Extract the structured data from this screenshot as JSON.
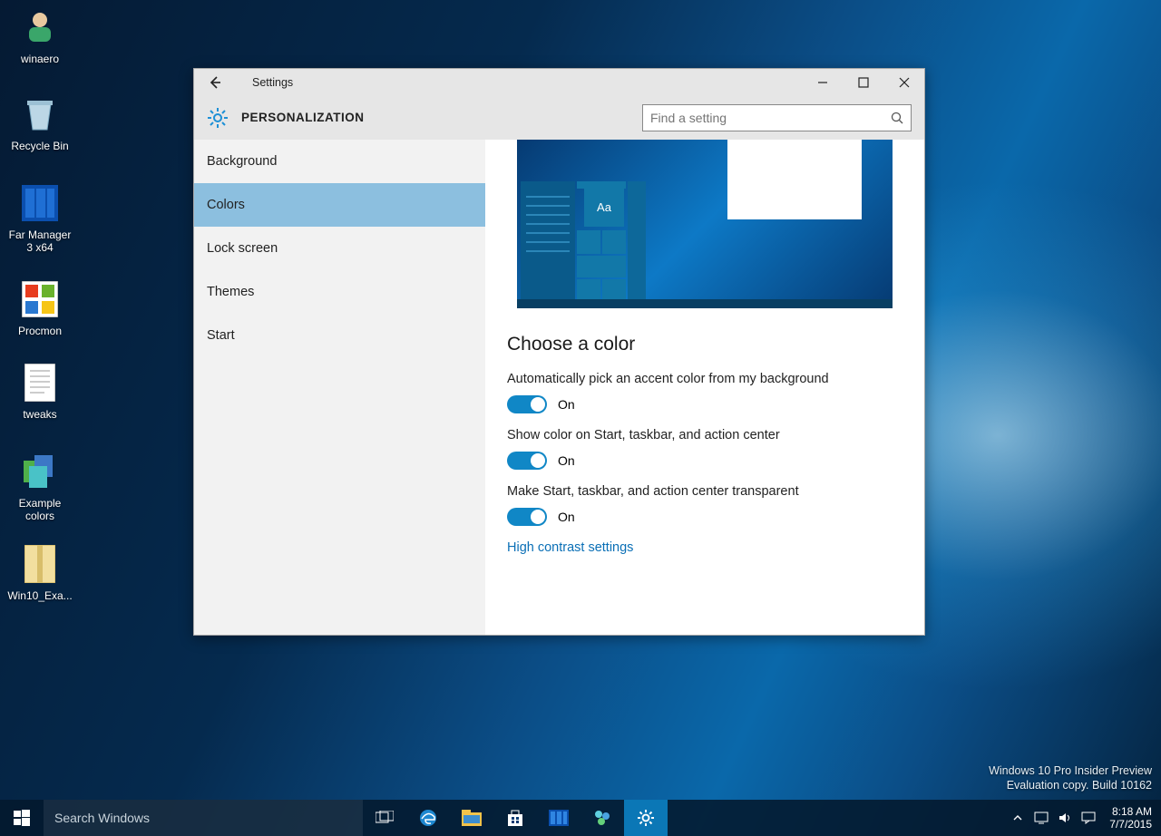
{
  "desktop_icons": [
    {
      "label": "winaero"
    },
    {
      "label": "Recycle Bin"
    },
    {
      "label": "Far Manager 3 x64"
    },
    {
      "label": "Procmon"
    },
    {
      "label": "tweaks"
    },
    {
      "label": "Example colors"
    },
    {
      "label": "Win10_Exa..."
    }
  ],
  "window": {
    "title": "Settings",
    "header": "PERSONALIZATION",
    "search_placeholder": "Find a setting"
  },
  "sidebar": {
    "items": [
      {
        "label": "Background"
      },
      {
        "label": "Colors"
      },
      {
        "label": "Lock screen"
      },
      {
        "label": "Themes"
      },
      {
        "label": "Start"
      }
    ],
    "active_index": 1
  },
  "main": {
    "preview_sample": "Aa",
    "section_heading": "Choose a color",
    "options": [
      {
        "label": "Automatically pick an accent color from my background",
        "state": "On",
        "on": true
      },
      {
        "label": "Show color on Start, taskbar, and action center",
        "state": "On",
        "on": true
      },
      {
        "label": "Make Start, taskbar, and action center transparent",
        "state": "On",
        "on": true
      }
    ],
    "link": "High contrast settings"
  },
  "watermark": {
    "line1": "Windows 10 Pro Insider Preview",
    "line2": "Evaluation copy. Build 10162"
  },
  "taskbar": {
    "search_placeholder": "Search Windows",
    "time": "8:18 AM",
    "date": "7/7/2015"
  }
}
